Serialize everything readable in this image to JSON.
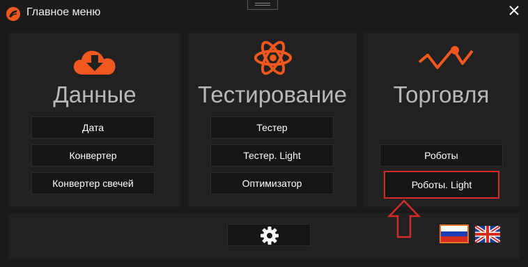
{
  "window": {
    "title": "Главное меню",
    "accent_color": "#f0581f",
    "highlight_color": "#d42b2b"
  },
  "sections": {
    "data": {
      "icon": "download-cloud-icon",
      "title": "Данные",
      "buttons": [
        "Дата",
        "Конвертер",
        "Конвертер свечей"
      ]
    },
    "testing": {
      "icon": "atom-icon",
      "title": "Тестирование",
      "buttons": [
        "Тестер",
        "Тестер. Light",
        "Оптимизатор"
      ]
    },
    "trading": {
      "icon": "trend-line-icon",
      "title": "Торговля",
      "buttons": [
        "Роботы",
        "Роботы. Light"
      ]
    }
  },
  "footer": {
    "settings_icon": "gear-icon",
    "languages": [
      "ru-flag-icon",
      "uk-flag-icon"
    ]
  }
}
